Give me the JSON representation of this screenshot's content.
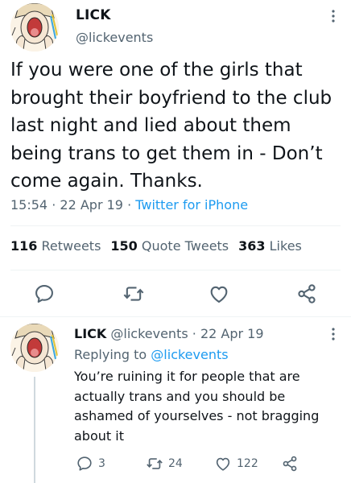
{
  "main_tweet": {
    "author_name": "LICK",
    "author_handle": "@lickevents",
    "text": "If you were one of the girls that brought their boyfriend to the club last night and lied about them being trans to get them in - Don’t come again. Thanks.",
    "time": "15:54",
    "separator": "·",
    "date": "22 Apr 19",
    "source": "Twitter for iPhone",
    "stats": {
      "retweets_count": "116",
      "retweets_label": "Retweets",
      "quotes_count": "150",
      "quotes_label": "Quote Tweets",
      "likes_count": "363",
      "likes_label": "Likes"
    },
    "actions": [
      "reply-icon",
      "retweet-icon",
      "like-icon",
      "share-icon"
    ]
  },
  "reply_tweet": {
    "author_name": "LICK",
    "author_handle": "@lickevents",
    "separator": "·",
    "date": "22 Apr 19",
    "replying_label": "Replying to",
    "replying_handle": "@lickevents",
    "text": "You’re ruining it for people that are actually trans and you should be ashamed of yourselves - not bragging about it",
    "reply_count": "3",
    "retweet_count": "24",
    "like_count": "122"
  },
  "colors": {
    "text": "#0f1419",
    "muted": "#536471",
    "link": "#1d9bf0",
    "divider": "#eff3f4",
    "thread_line": "#cfd9de"
  }
}
